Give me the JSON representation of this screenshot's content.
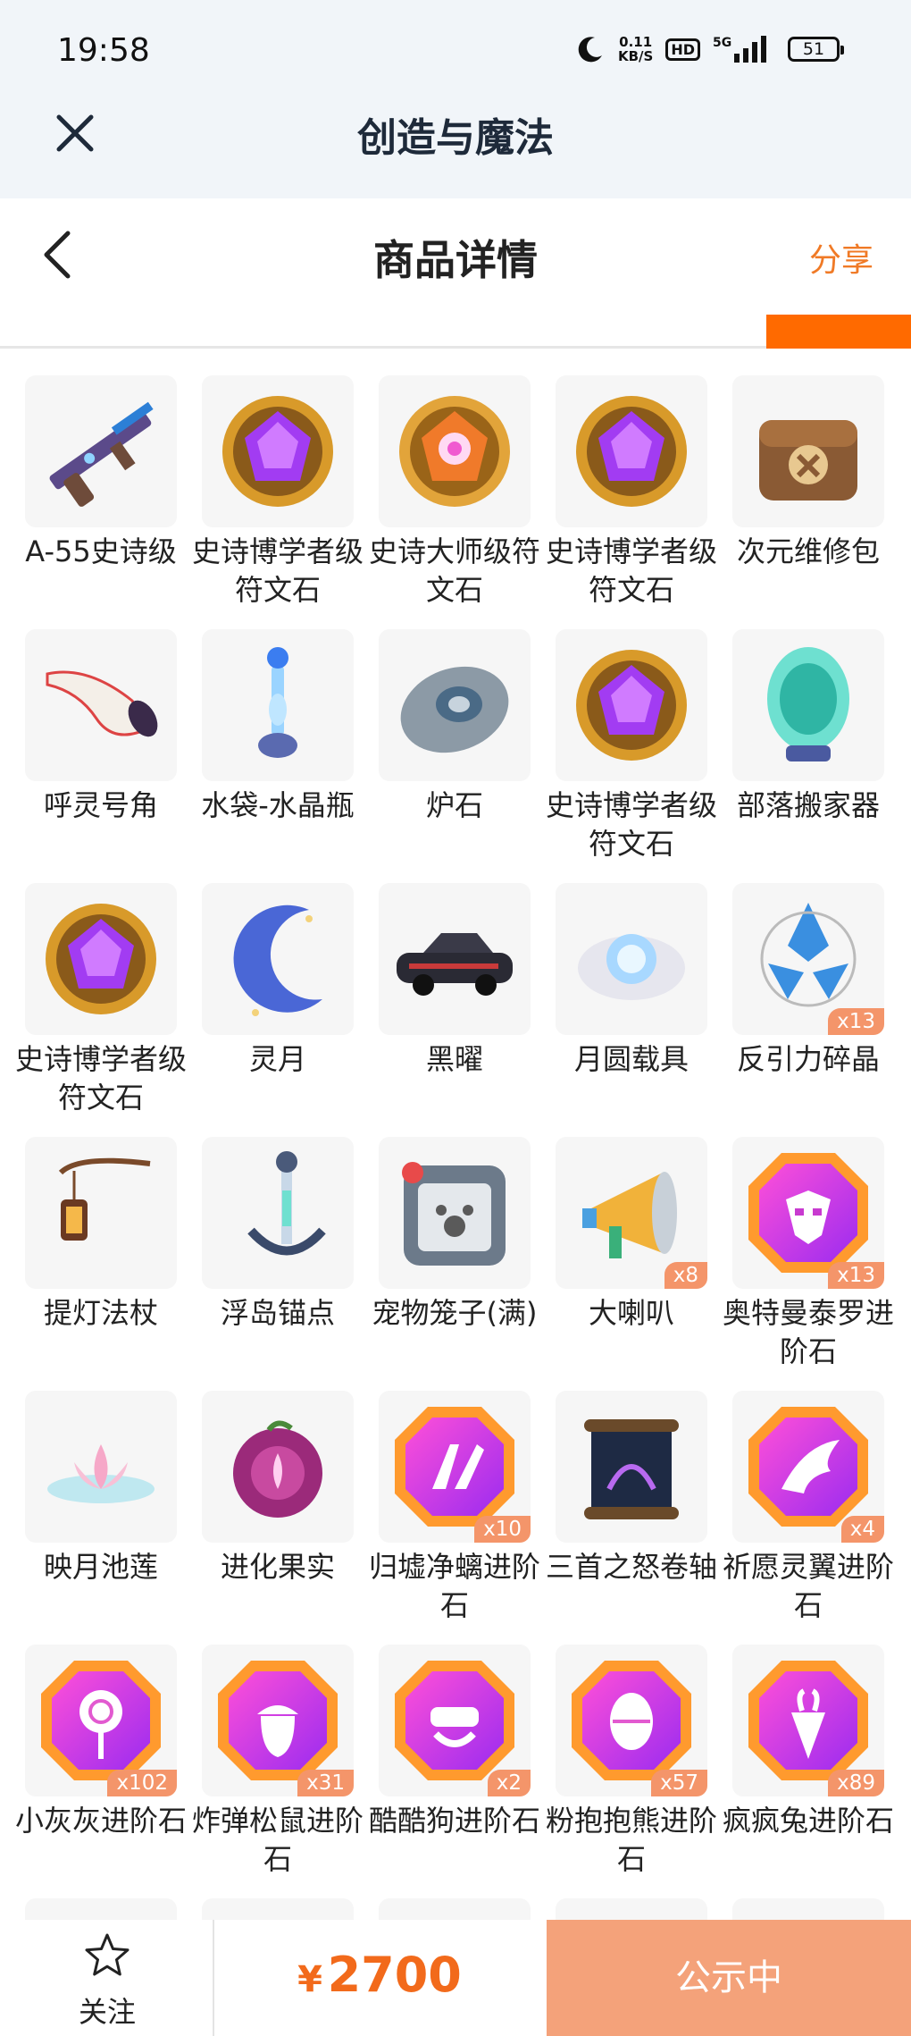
{
  "status_bar": {
    "time": "19:58",
    "net_speed_value": "0.11",
    "net_speed_unit": "KB/S",
    "hd": "HD",
    "network": "5G",
    "battery": "51"
  },
  "app": {
    "title": "创造与魔法"
  },
  "page": {
    "title": "商品详情",
    "share": "分享"
  },
  "accent_color": "#ff6a00",
  "items": [
    {
      "name": "A-55史诗级",
      "icon": "rifle-icon"
    },
    {
      "name": "史诗博学者级符文石",
      "icon": "purple-rune-icon"
    },
    {
      "name": "史诗大师级符文石",
      "icon": "orange-rune-icon"
    },
    {
      "name": "史诗博学者级符文石",
      "icon": "purple-rune-icon"
    },
    {
      "name": "次元维修包",
      "icon": "repair-bag-icon"
    },
    {
      "name": "呼灵号角",
      "icon": "horn-icon"
    },
    {
      "name": "水袋-水晶瓶",
      "icon": "crystal-bottle-icon"
    },
    {
      "name": "炉石",
      "icon": "hearthstone-icon"
    },
    {
      "name": "史诗博学者级符文石",
      "icon": "purple-rune-icon"
    },
    {
      "name": "部落搬家器",
      "icon": "tribe-egg-icon"
    },
    {
      "name": "史诗博学者级符文石",
      "icon": "purple-rune-icon"
    },
    {
      "name": "灵月",
      "icon": "crescent-moon-icon"
    },
    {
      "name": "黑曜",
      "icon": "car-icon"
    },
    {
      "name": "月圆载具",
      "icon": "moon-orb-icon"
    },
    {
      "name": "反引力碎晶",
      "icon": "antigravity-crystal-icon",
      "count": "x13"
    },
    {
      "name": "提灯法杖",
      "icon": "lantern-staff-icon"
    },
    {
      "name": "浮岛锚点",
      "icon": "anchor-icon"
    },
    {
      "name": "宠物笼子(满)",
      "icon": "pet-cage-icon"
    },
    {
      "name": "大喇叭",
      "icon": "megaphone-icon",
      "count": "x8"
    },
    {
      "name": "奥特曼泰罗进阶石",
      "icon": "gem-ultraman-icon",
      "count": "x13"
    },
    {
      "name": "映月池莲",
      "icon": "lotus-icon"
    },
    {
      "name": "进化果实",
      "icon": "evolution-fruit-icon"
    },
    {
      "name": "归墟净螭进阶石",
      "icon": "gem-dragon-icon",
      "count": "x10"
    },
    {
      "name": "三首之怒卷轴",
      "icon": "scroll-icon"
    },
    {
      "name": "祈愿灵翼进阶石",
      "icon": "gem-wing-icon",
      "count": "x4"
    },
    {
      "name": "小灰灰进阶石",
      "icon": "gem-lollipop-icon",
      "count": "x102"
    },
    {
      "name": "炸弹松鼠进阶石",
      "icon": "gem-acorn-icon",
      "count": "x31"
    },
    {
      "name": "酷酷狗进阶石",
      "icon": "gem-dog-icon",
      "count": "x2"
    },
    {
      "name": "粉抱抱熊进阶石",
      "icon": "gem-egg-icon",
      "count": "x57"
    },
    {
      "name": "疯疯兔进阶石",
      "icon": "gem-carrot-icon",
      "count": "x89"
    }
  ],
  "bottom": {
    "follow": "关注",
    "currency": "¥",
    "price": "2700",
    "status": "公示中"
  }
}
